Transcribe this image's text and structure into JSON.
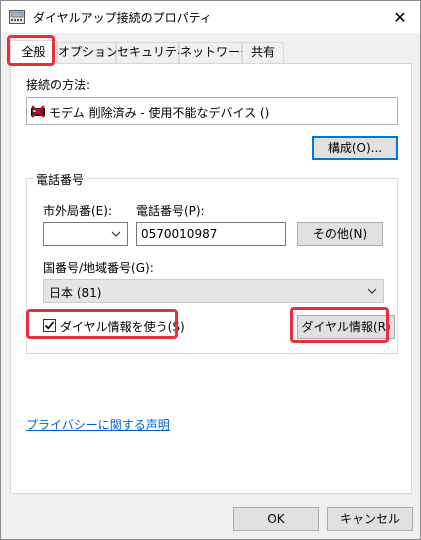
{
  "window": {
    "title": "ダイヤルアップ接続のプロパティ",
    "close_glyph": "✕"
  },
  "tabs": [
    {
      "label": "全般",
      "active": true
    },
    {
      "label": "オプション",
      "active": false
    },
    {
      "label": "セキュリティ",
      "active": false
    },
    {
      "label": "ネットワーク",
      "active": false
    },
    {
      "label": "共有",
      "active": false
    }
  ],
  "general": {
    "connect_using_label": "接続の方法:",
    "device_text": "モデム 削除済み - 使用不能なデバイス ()",
    "configure_button": "構成(O)...",
    "phone_group_title": "電話番号",
    "area_code_label": "市外局番(E):",
    "area_code_value": "",
    "phone_number_label": "電話番号(P):",
    "phone_number_value": "0570010987",
    "alternates_button": "その他(N)",
    "country_label": "国番号/地域番号(G):",
    "country_value": "日本 (81)",
    "use_dialing_rules_label": "ダイヤル情報を使う(S)",
    "use_dialing_rules_checked": true,
    "dialing_rules_button": "ダイヤル情報(R)",
    "privacy_link": "プライバシーに関する声明"
  },
  "footer": {
    "ok_button": "OK",
    "cancel_button": "キャンセル"
  },
  "colors": {
    "highlight": "#e8303a",
    "link": "#0066cc",
    "focus": "#0078d7"
  }
}
